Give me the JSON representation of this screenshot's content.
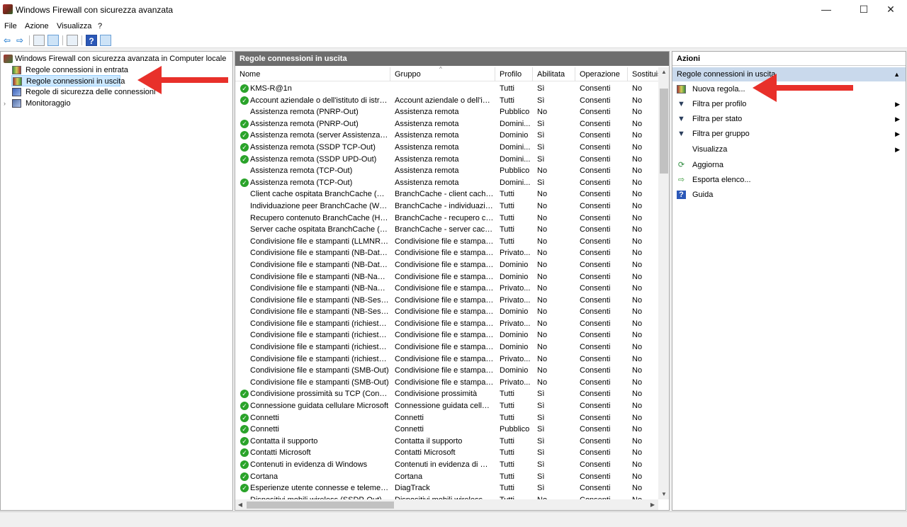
{
  "window": {
    "title": "Windows Firewall con sicurezza avanzata",
    "minimize": "—",
    "maximize": "☐",
    "close": "✕"
  },
  "menu": {
    "file": "File",
    "azione": "Azione",
    "visualizza": "Visualizza",
    "help": "?"
  },
  "tree": {
    "root": "Windows Firewall con sicurezza avanzata in Computer locale",
    "items": [
      {
        "label": "Regole connessioni in entrata"
      },
      {
        "label": "Regole connessioni in uscita"
      },
      {
        "label": "Regole di sicurezza delle connessioni"
      },
      {
        "label": "Monitoraggio"
      }
    ]
  },
  "center": {
    "title": "Regole connessioni in uscita",
    "columns": [
      "Nome",
      "Gruppo",
      "Profilo",
      "Abilitata",
      "Operazione",
      "Sostituis"
    ],
    "rows": [
      {
        "enabled": true,
        "name": "KMS-R@1n",
        "group": "",
        "profile": "Tutti",
        "on": "Sì",
        "op": "Consenti",
        "over": "No"
      },
      {
        "enabled": true,
        "name": "Account aziendale o dell'istituto di istruzi...",
        "group": "Account aziendale o dell'isti...",
        "profile": "Tutti",
        "on": "Sì",
        "op": "Consenti",
        "over": "No"
      },
      {
        "enabled": false,
        "name": "Assistenza remota (PNRP-Out)",
        "group": "Assistenza remota",
        "profile": "Pubblico",
        "on": "No",
        "op": "Consenti",
        "over": "No"
      },
      {
        "enabled": true,
        "name": "Assistenza remota (PNRP-Out)",
        "group": "Assistenza remota",
        "profile": "Domini...",
        "on": "Sì",
        "op": "Consenti",
        "over": "No"
      },
      {
        "enabled": true,
        "name": "Assistenza remota (server Assistenza rem...",
        "group": "Assistenza remota",
        "profile": "Dominio",
        "on": "Sì",
        "op": "Consenti",
        "over": "No"
      },
      {
        "enabled": true,
        "name": "Assistenza remota (SSDP TCP-Out)",
        "group": "Assistenza remota",
        "profile": "Domini...",
        "on": "Sì",
        "op": "Consenti",
        "over": "No"
      },
      {
        "enabled": true,
        "name": "Assistenza remota (SSDP UPD-Out)",
        "group": "Assistenza remota",
        "profile": "Domini...",
        "on": "Sì",
        "op": "Consenti",
        "over": "No"
      },
      {
        "enabled": false,
        "name": "Assistenza remota (TCP-Out)",
        "group": "Assistenza remota",
        "profile": "Pubblico",
        "on": "No",
        "op": "Consenti",
        "over": "No"
      },
      {
        "enabled": true,
        "name": "Assistenza remota (TCP-Out)",
        "group": "Assistenza remota",
        "profile": "Domini...",
        "on": "Sì",
        "op": "Consenti",
        "over": "No"
      },
      {
        "enabled": false,
        "name": "Client cache ospitata BranchCache (HTT...",
        "group": "BranchCache - client cache ...",
        "profile": "Tutti",
        "on": "No",
        "op": "Consenti",
        "over": "No"
      },
      {
        "enabled": false,
        "name": "Individuazione peer BranchCache (WSD-...",
        "group": "BranchCache - individuazio...",
        "profile": "Tutti",
        "on": "No",
        "op": "Consenti",
        "over": "No"
      },
      {
        "enabled": false,
        "name": "Recupero contenuto BranchCache (HTT...",
        "group": "BranchCache - recupero co...",
        "profile": "Tutti",
        "on": "No",
        "op": "Consenti",
        "over": "No"
      },
      {
        "enabled": false,
        "name": "Server cache ospitata BranchCache (HTT...",
        "group": "BranchCache - server cache ...",
        "profile": "Tutti",
        "on": "No",
        "op": "Consenti",
        "over": "No"
      },
      {
        "enabled": false,
        "name": "Condivisione file e stampanti (LLMNR-U...",
        "group": "Condivisione file e stampanti",
        "profile": "Tutti",
        "on": "No",
        "op": "Consenti",
        "over": "No"
      },
      {
        "enabled": false,
        "name": "Condivisione file e stampanti (NB-Datagr...",
        "group": "Condivisione file e stampanti",
        "profile": "Privato...",
        "on": "No",
        "op": "Consenti",
        "over": "No"
      },
      {
        "enabled": false,
        "name": "Condivisione file e stampanti (NB-Datagr...",
        "group": "Condivisione file e stampanti",
        "profile": "Dominio",
        "on": "No",
        "op": "Consenti",
        "over": "No"
      },
      {
        "enabled": false,
        "name": "Condivisione file e stampanti (NB-Name...",
        "group": "Condivisione file e stampanti",
        "profile": "Dominio",
        "on": "No",
        "op": "Consenti",
        "over": "No"
      },
      {
        "enabled": false,
        "name": "Condivisione file e stampanti (NB-Name...",
        "group": "Condivisione file e stampanti",
        "profile": "Privato...",
        "on": "No",
        "op": "Consenti",
        "over": "No"
      },
      {
        "enabled": false,
        "name": "Condivisione file e stampanti (NB-Sessio...",
        "group": "Condivisione file e stampanti",
        "profile": "Privato...",
        "on": "No",
        "op": "Consenti",
        "over": "No"
      },
      {
        "enabled": false,
        "name": "Condivisione file e stampanti (NB-Sessio...",
        "group": "Condivisione file e stampanti",
        "profile": "Dominio",
        "on": "No",
        "op": "Consenti",
        "over": "No"
      },
      {
        "enabled": false,
        "name": "Condivisione file e stampanti (richiesta e...",
        "group": "Condivisione file e stampanti",
        "profile": "Privato...",
        "on": "No",
        "op": "Consenti",
        "over": "No"
      },
      {
        "enabled": false,
        "name": "Condivisione file e stampanti (richiesta e...",
        "group": "Condivisione file e stampanti",
        "profile": "Dominio",
        "on": "No",
        "op": "Consenti",
        "over": "No"
      },
      {
        "enabled": false,
        "name": "Condivisione file e stampanti (richiesta e...",
        "group": "Condivisione file e stampanti",
        "profile": "Dominio",
        "on": "No",
        "op": "Consenti",
        "over": "No"
      },
      {
        "enabled": false,
        "name": "Condivisione file e stampanti (richiesta e...",
        "group": "Condivisione file e stampanti",
        "profile": "Privato...",
        "on": "No",
        "op": "Consenti",
        "over": "No"
      },
      {
        "enabled": false,
        "name": "Condivisione file e stampanti (SMB-Out)",
        "group": "Condivisione file e stampanti",
        "profile": "Dominio",
        "on": "No",
        "op": "Consenti",
        "over": "No"
      },
      {
        "enabled": false,
        "name": "Condivisione file e stampanti (SMB-Out)",
        "group": "Condivisione file e stampanti",
        "profile": "Privato...",
        "on": "No",
        "op": "Consenti",
        "over": "No"
      },
      {
        "enabled": true,
        "name": "Condivisione prossimità su TCP (Condivi...",
        "group": "Condivisione prossimità",
        "profile": "Tutti",
        "on": "Sì",
        "op": "Consenti",
        "over": "No"
      },
      {
        "enabled": true,
        "name": "Connessione guidata cellulare Microsoft",
        "group": "Connessione guidata cellula...",
        "profile": "Tutti",
        "on": "Sì",
        "op": "Consenti",
        "over": "No"
      },
      {
        "enabled": true,
        "name": "Connetti",
        "group": "Connetti",
        "profile": "Tutti",
        "on": "Sì",
        "op": "Consenti",
        "over": "No"
      },
      {
        "enabled": true,
        "name": "Connetti",
        "group": "Connetti",
        "profile": "Pubblico",
        "on": "Sì",
        "op": "Consenti",
        "over": "No"
      },
      {
        "enabled": true,
        "name": "Contatta il supporto",
        "group": "Contatta il supporto",
        "profile": "Tutti",
        "on": "Sì",
        "op": "Consenti",
        "over": "No"
      },
      {
        "enabled": true,
        "name": "Contatti Microsoft",
        "group": "Contatti Microsoft",
        "profile": "Tutti",
        "on": "Sì",
        "op": "Consenti",
        "over": "No"
      },
      {
        "enabled": true,
        "name": "Contenuti in evidenza di Windows",
        "group": "Contenuti in evidenza di Wi...",
        "profile": "Tutti",
        "on": "Sì",
        "op": "Consenti",
        "over": "No"
      },
      {
        "enabled": true,
        "name": "Cortana",
        "group": "Cortana",
        "profile": "Tutti",
        "on": "Sì",
        "op": "Consenti",
        "over": "No"
      },
      {
        "enabled": true,
        "name": "Esperienze utente connesse e telemetria",
        "group": "DiagTrack",
        "profile": "Tutti",
        "on": "Sì",
        "op": "Consenti",
        "over": "No"
      },
      {
        "enabled": false,
        "name": "Dispositivi mobili wireless (SSDP-Out)",
        "group": "Dispositivi mobili wireless",
        "profile": "Tutti",
        "on": "No",
        "op": "Consenti",
        "over": "No"
      }
    ]
  },
  "actions": {
    "title": "Azioni",
    "section": "Regole connessioni in uscita",
    "items": [
      {
        "label": "Nuova regola...",
        "icon": "new-rule-icon",
        "sub": false
      },
      {
        "label": "Filtra per profilo",
        "icon": "filter-icon",
        "sub": true
      },
      {
        "label": "Filtra per stato",
        "icon": "filter-icon",
        "sub": true
      },
      {
        "label": "Filtra per gruppo",
        "icon": "filter-icon",
        "sub": true
      },
      {
        "label": "Visualizza",
        "icon": "",
        "sub": true
      },
      {
        "label": "Aggiorna",
        "icon": "refresh-icon",
        "sub": false
      },
      {
        "label": "Esporta elenco...",
        "icon": "export-icon",
        "sub": false
      },
      {
        "label": "Guida",
        "icon": "help-icon",
        "sub": false
      }
    ]
  },
  "colors": {
    "accent": "#e8302a",
    "selection": "#cce8ff",
    "header": "#6d6d6d",
    "section": "#c9d9ec",
    "enabled": "#2aa32a"
  }
}
